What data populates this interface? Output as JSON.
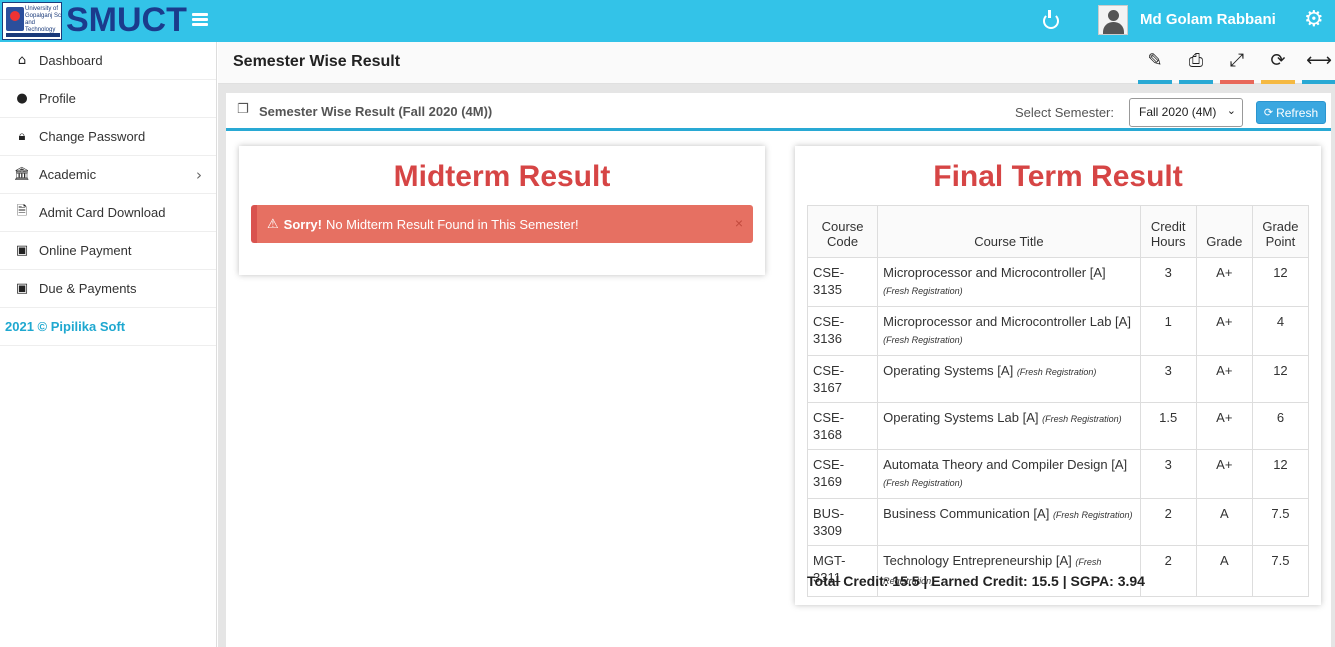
{
  "header": {
    "logo_text": "University of Gopalganj Science and Technology",
    "brand": "SMUCT",
    "user_name": "Md Golam Rabbani"
  },
  "sidebar": {
    "items": [
      {
        "label": "Dashboard",
        "icon": "home-icon"
      },
      {
        "label": "Profile",
        "icon": "user-icon"
      },
      {
        "label": "Change Password",
        "icon": "lock-icon"
      },
      {
        "label": "Academic",
        "icon": "bank-icon"
      },
      {
        "label": "Admit Card Download",
        "icon": "document-icon"
      },
      {
        "label": "Online Payment",
        "icon": "money-icon"
      },
      {
        "label": "Due & Payments",
        "icon": "money-icon"
      }
    ],
    "footer": "2021 © Pipilika Soft"
  },
  "page": {
    "title": "Semester Wise Result",
    "toolbar_colors": [
      "#29a9d4",
      "#29a9d4",
      "#e8685a",
      "#f5b942",
      "#29a9d4"
    ]
  },
  "panel": {
    "title": "Semester Wise Result (Fall 2020 (4M))",
    "select_label": "Select Semester:",
    "select_value": "Fall 2020 (4M)",
    "refresh_label": "Refresh",
    "accent": "#29a9d4"
  },
  "midterm": {
    "title": "Midterm Result",
    "alert_strong": "Sorry!",
    "alert_text": "No Midterm Result Found in This Semester!",
    "close": "×",
    "alert_color": "#e67062"
  },
  "final": {
    "title": "Final Term Result",
    "title_color": "#d64545",
    "headers": [
      "Course Code",
      "Course Title",
      "Credit Hours",
      "Grade",
      "Grade Point"
    ],
    "rows": [
      {
        "code": "CSE-3135",
        "title": "Microprocessor and Microcontroller [A]",
        "reg": "(Fresh Registration)",
        "credit": "3",
        "grade": "A+",
        "point": "12"
      },
      {
        "code": "CSE-3136",
        "title": "Microprocessor and Microcontroller Lab [A]",
        "reg": "(Fresh Registration)",
        "credit": "1",
        "grade": "A+",
        "point": "4"
      },
      {
        "code": "CSE-3167",
        "title": "Operating Systems [A]",
        "reg": "(Fresh Registration)",
        "credit": "3",
        "grade": "A+",
        "point": "12"
      },
      {
        "code": "CSE-3168",
        "title": "Operating Systems Lab [A]",
        "reg": "(Fresh Registration)",
        "credit": "1.5",
        "grade": "A+",
        "point": "6"
      },
      {
        "code": "CSE-3169",
        "title": "Automata Theory and Compiler Design [A]",
        "reg": "(Fresh Registration)",
        "credit": "3",
        "grade": "A+",
        "point": "12"
      },
      {
        "code": "BUS-3309",
        "title": "Business Communication [A]",
        "reg": "(Fresh Registration)",
        "credit": "2",
        "grade": "A",
        "point": "7.5"
      },
      {
        "code": "MGT-3311",
        "title": "Technology Entrepreneurship [A]",
        "reg": "(Fresh Registration)",
        "credit": "2",
        "grade": "A",
        "point": "7.5"
      }
    ],
    "summary": "Total Credit: 15.5 | Earned Credit: 15.5 | SGPA: 3.94"
  }
}
